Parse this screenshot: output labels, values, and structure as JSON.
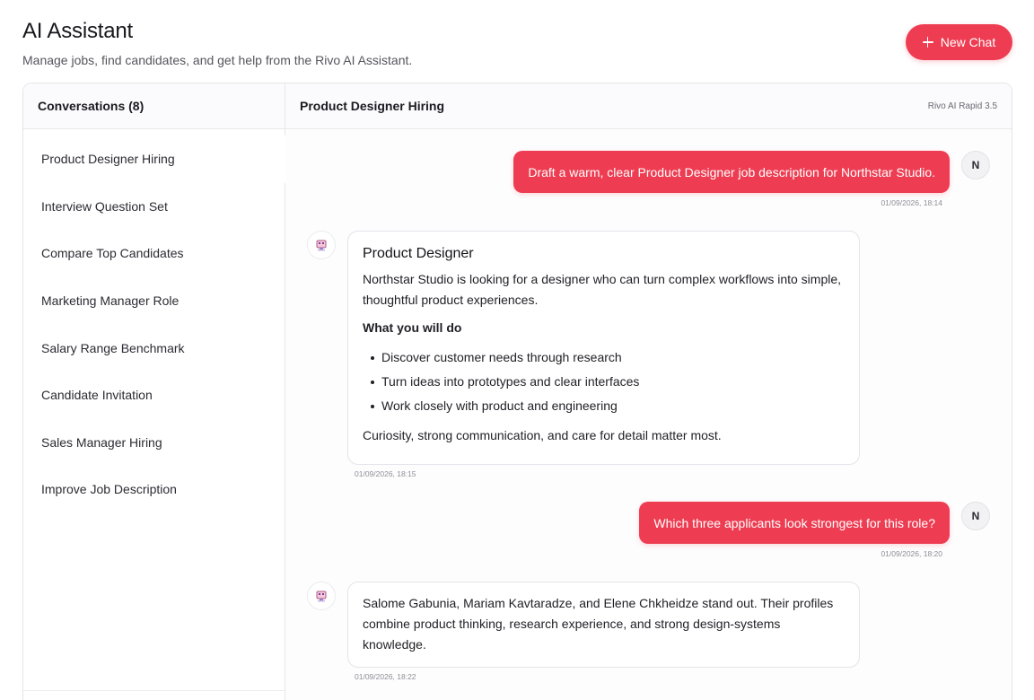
{
  "page": {
    "title": "AI Assistant",
    "subtitle": "Manage jobs, find candidates, and get help from the Rivo AI Assistant.",
    "new_chat_label": "New Chat"
  },
  "sidebar": {
    "header": "Conversations (8)",
    "items": [
      {
        "label": "Product Designer Hiring"
      },
      {
        "label": "Interview Question Set"
      },
      {
        "label": "Compare Top Candidates"
      },
      {
        "label": "Marketing Manager Role"
      },
      {
        "label": "Salary Range Benchmark"
      },
      {
        "label": "Candidate Invitation"
      },
      {
        "label": "Sales Manager Hiring"
      },
      {
        "label": "Improve Job Description"
      }
    ]
  },
  "chat": {
    "title": "Product Designer Hiring",
    "model": "Rivo AI Rapid 3.5",
    "user_initial": "N",
    "messages": [
      {
        "role": "user",
        "text": "Draft a warm, clear Product Designer job description for Northstar Studio.",
        "time": "01/09/2026, 18:14"
      },
      {
        "role": "assistant",
        "heading": "Product Designer",
        "intro": "Northstar Studio is looking for a designer who can turn complex workflows into simple, thoughtful product experiences.",
        "section": "What you will do",
        "bullets": [
          "Discover customer needs through research",
          "Turn ideas into prototypes and clear interfaces",
          "Work closely with product and engineering"
        ],
        "closing": "Curiosity, strong communication, and care for detail matter most.",
        "time": "01/09/2026, 18:15"
      },
      {
        "role": "user",
        "text": "Which three applicants look strongest for this role?",
        "time": "01/09/2026, 18:20"
      },
      {
        "role": "assistant",
        "text": "Salome Gabunia, Mariam Kavtaradze, and Elene Chkheidze stand out. Their profiles combine product thinking, research experience, and strong design-systems knowledge.",
        "time": "01/09/2026, 18:22"
      }
    ]
  },
  "icons": {
    "new_chat": "plus-icon",
    "assistant_avatar": "robot-icon"
  },
  "colors": {
    "accent": "#ee3d52",
    "border": "#e5e5ea"
  }
}
